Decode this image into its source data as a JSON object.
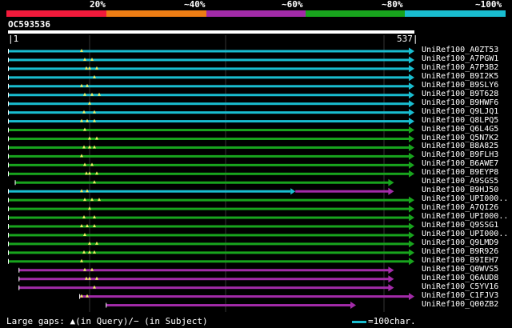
{
  "identity_legend": {
    "labels": [
      "20%",
      "~40%",
      "~60%",
      "~80%",
      "~100%"
    ],
    "colors": [
      "#f21a3b",
      "#ee7d14",
      "#a22ba8",
      "#18a41d",
      "#19bdd0"
    ]
  },
  "query": {
    "name": "OC593536",
    "start_label": "1",
    "end_label": "537",
    "length": 537
  },
  "footer": {
    "gaps_text": "Large gaps: ▲(in Query)/− (in Subject)",
    "scale_text": "=100char."
  },
  "chart_data": {
    "type": "alignment-map",
    "title": "OC593536",
    "x_range": [
      1,
      537
    ],
    "series": [
      {
        "name": "UniRef100_A0ZT53",
        "color": "#19bdd0",
        "start": 1,
        "end": 537
      },
      {
        "name": "UniRef100_A7PGW1",
        "color": "#19bdd0",
        "start": 1,
        "end": 537
      },
      {
        "name": "UniRef100_A7P3B2",
        "color": "#19bdd0",
        "start": 1,
        "end": 537
      },
      {
        "name": "UniRef100_B9I2K5",
        "color": "#19bdd0",
        "start": 1,
        "end": 537
      },
      {
        "name": "UniRef100_B9SLY6",
        "color": "#19bdd0",
        "start": 1,
        "end": 537
      },
      {
        "name": "UniRef100_B9T628",
        "color": "#19bdd0",
        "start": 1,
        "end": 537
      },
      {
        "name": "UniRef100_B9HWF6",
        "color": "#19bdd0",
        "start": 1,
        "end": 537
      },
      {
        "name": "UniRef100_Q9LJQ1",
        "color": "#19bdd0",
        "start": 1,
        "end": 537
      },
      {
        "name": "UniRef100_Q8LPQ5",
        "color": "#19bdd0",
        "start": 1,
        "end": 537
      },
      {
        "name": "UniRef100_Q6L4G5",
        "color": "#18a41d",
        "start": 1,
        "end": 537
      },
      {
        "name": "UniRef100_Q5N7K2",
        "color": "#18a41d",
        "start": 1,
        "end": 537
      },
      {
        "name": "UniRef100_B8A825",
        "color": "#18a41d",
        "start": 1,
        "end": 537
      },
      {
        "name": "UniRef100_B9FLH3",
        "color": "#18a41d",
        "start": 1,
        "end": 537
      },
      {
        "name": "UniRef100_B6AWE7",
        "color": "#18a41d",
        "start": 1,
        "end": 537
      },
      {
        "name": "UniRef100_B9EYP8",
        "color": "#18a41d",
        "start": 1,
        "end": 537
      },
      {
        "name": "UniRef100_A9SGS5",
        "color": "#18a41d",
        "start": 10,
        "end": 510
      },
      {
        "name": "UniRef100_B9HJ50",
        "color": "#19bdd0",
        "start": 1,
        "end": 380,
        "tail_color": "#a22ba8",
        "tail_end": 510
      },
      {
        "name": "UniRef100_UPI000..",
        "color": "#18a41d",
        "start": 1,
        "end": 537
      },
      {
        "name": "UniRef100_A7QI26",
        "color": "#18a41d",
        "start": 1,
        "end": 537
      },
      {
        "name": "UniRef100_UPI000..",
        "color": "#18a41d",
        "start": 1,
        "end": 537
      },
      {
        "name": "UniRef100_Q9SSG1",
        "color": "#18a41d",
        "start": 1,
        "end": 537
      },
      {
        "name": "UniRef100_UPI000..",
        "color": "#18a41d",
        "start": 1,
        "end": 537
      },
      {
        "name": "UniRef100_Q9LMD9",
        "color": "#18a41d",
        "start": 1,
        "end": 537
      },
      {
        "name": "UniRef100_B9R926",
        "color": "#18a41d",
        "start": 1,
        "end": 537
      },
      {
        "name": "UniRef100_B9IEH7",
        "color": "#18a41d",
        "start": 1,
        "end": 537
      },
      {
        "name": "UniRef100_Q0WVS5",
        "color": "#a22ba8",
        "start": 15,
        "end": 510
      },
      {
        "name": "UniRef100_Q6AUD8",
        "color": "#a22ba8",
        "start": 15,
        "end": 510
      },
      {
        "name": "UniRef100_C5YV16",
        "color": "#a22ba8",
        "start": 15,
        "end": 510
      },
      {
        "name": "UniRef100_C1FJV3",
        "color": "#a22ba8",
        "start": 95,
        "end": 537
      },
      {
        "name": "UniRef100_Q00ZB2",
        "color": "#a22ba8",
        "start": 130,
        "end": 460
      }
    ]
  }
}
